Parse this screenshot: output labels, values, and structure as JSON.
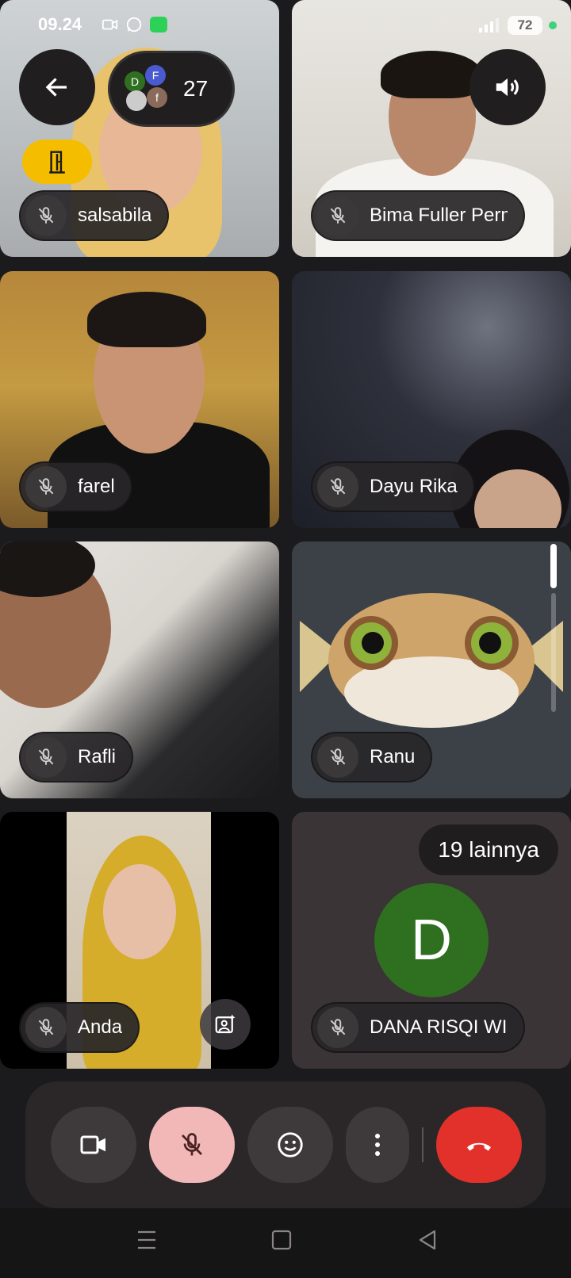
{
  "status_bar": {
    "time": "09.24",
    "battery": "72"
  },
  "participants_chip": {
    "count": "27",
    "avatars": [
      "D",
      "F",
      "f"
    ]
  },
  "tiles": [
    {
      "name": "salsabila",
      "mic": "muted"
    },
    {
      "name": "Bima Fuller Perma",
      "mic": "muted"
    },
    {
      "name": "farel",
      "mic": "muted"
    },
    {
      "name": "Dayu Rika",
      "mic": "muted"
    },
    {
      "name": "Rafli",
      "mic": "muted"
    },
    {
      "name": "Ranu",
      "mic": "muted"
    },
    {
      "name": "Anda",
      "mic": "muted"
    },
    {
      "name": "DANA RISQI WIJAY",
      "mic": "muted",
      "avatar_letter": "D",
      "avatar_color": "#2f7020"
    }
  ],
  "more_participants": "19 lainnya",
  "controls": {
    "camera": "video-camera-icon",
    "mic": "mic-off-icon",
    "reactions": "emoji-icon",
    "more": "more-vert-icon",
    "end_call": "call-end-icon"
  },
  "colors": {
    "end_call": "#e1312a",
    "mic_muted_bg": "#f2b8b8",
    "exit_chip": "#f5bd00"
  }
}
